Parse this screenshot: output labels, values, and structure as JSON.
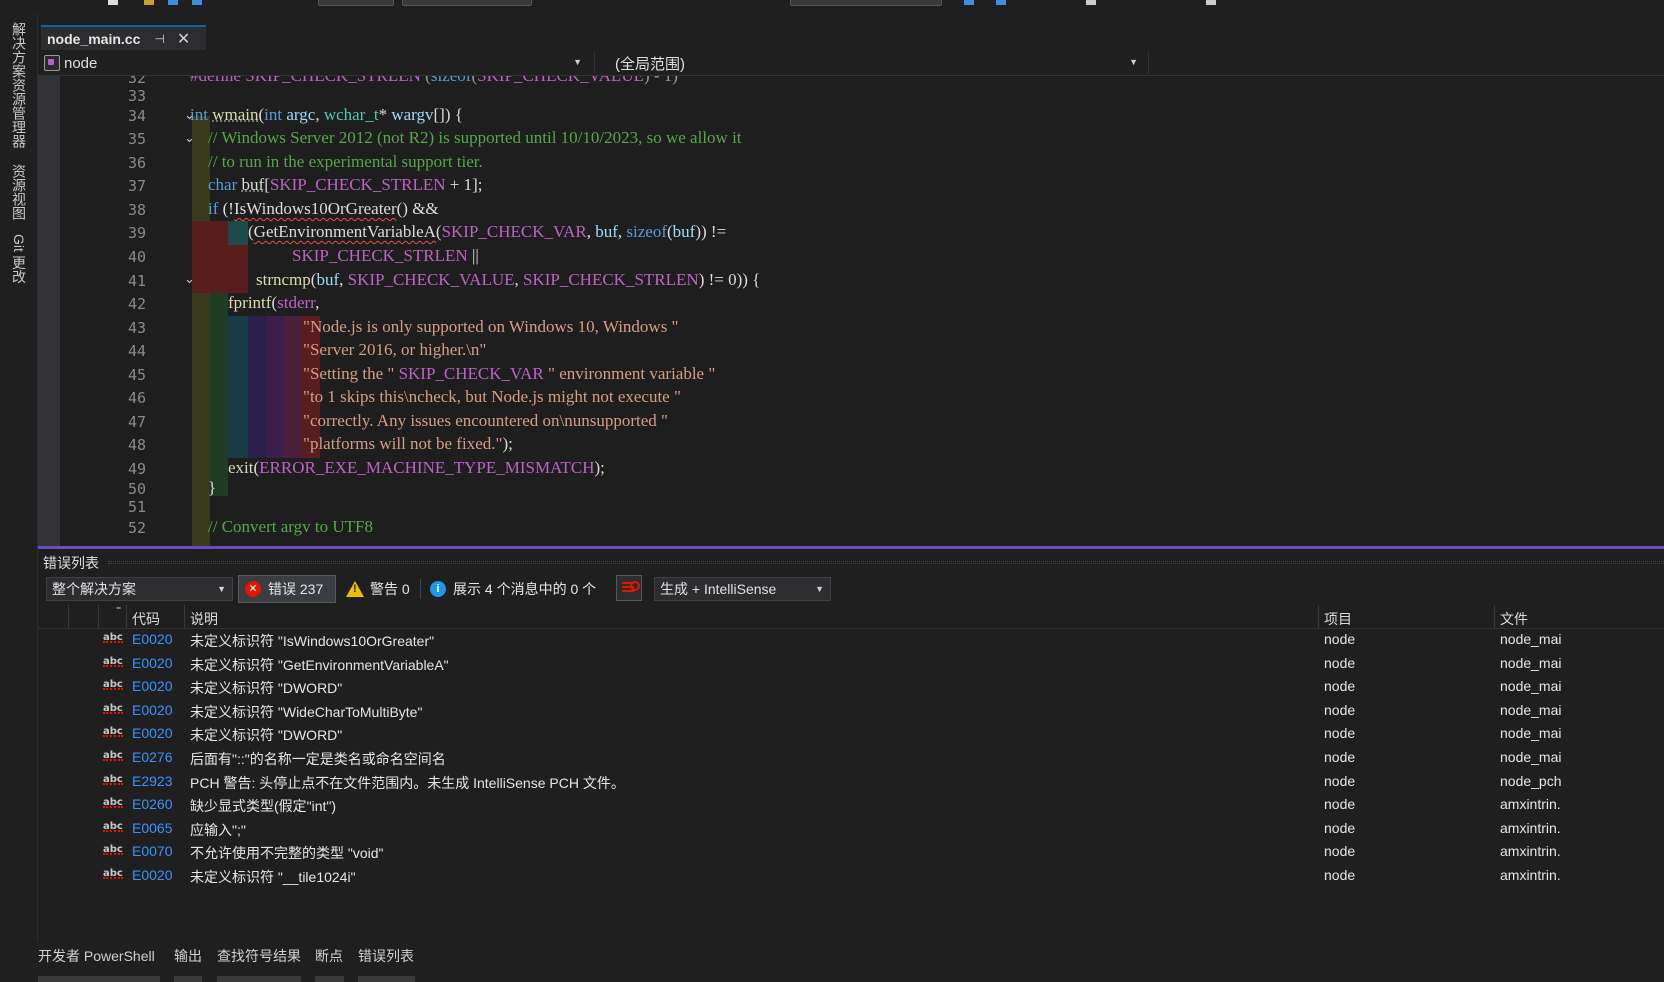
{
  "left_rail": {
    "tabs": [
      "解决方案资源管理器",
      "资源视图",
      "Git 更改"
    ]
  },
  "tab": {
    "title": "node_main.cc",
    "pin": "⊣",
    "close": "✕"
  },
  "navbar": {
    "project": "node",
    "scope": "(全局范围)"
  },
  "editor": {
    "line_numbers": [
      "32",
      "33",
      "34",
      "35",
      "36",
      "37",
      "38",
      "39",
      "40",
      "41",
      "42",
      "43",
      "44",
      "45",
      "46",
      "47",
      "48",
      "49",
      "50",
      "51",
      "52"
    ],
    "lines": [
      "#define SKIP_CHECK_STRLEN (sizeof(SKIP_CHECK_VALUE) - 1)",
      "",
      "int wmain(int argc, wchar_t* wargv[]) {",
      "  // Windows Server 2012 (not R2) is supported until 10/10/2023, so we allow it",
      "  // to run in the experimental support tier.",
      "  char buf[SKIP_CHECK_STRLEN + 1];",
      "  if (!IsWindows10OrGreater() &&",
      "      (GetEnvironmentVariableA(SKIP_CHECK_VAR, buf, sizeof(buf)) !=",
      "           SKIP_CHECK_STRLEN ||",
      "       strncmp(buf, SKIP_CHECK_VALUE, SKIP_CHECK_STRLEN) != 0)) {",
      "    fprintf(stderr,",
      "            \"Node.js is only supported on Windows 10, Windows \"",
      "            \"Server 2016, or higher.\\n\"",
      "            \"Setting the \" SKIP_CHECK_VAR \" environment variable \"",
      "            \"to 1 skips this\\ncheck, but Node.js might not execute \"",
      "            \"correctly. Any issues encountered on\\nunsupported \"",
      "            \"platforms will not be fixed.\");",
      "    exit(ERROR_EXE_MACHINE_TYPE_MISMATCH);",
      "  }",
      "",
      "  // Convert argv to UTF8"
    ],
    "colors": {
      "keyword": "#569cd6",
      "type": "#4ec9b0",
      "function": "#dcdcaa",
      "comment": "#57a64a",
      "string": "#d69d85",
      "macro": "#bd63c5",
      "param": "#9cdcfe"
    }
  },
  "error_list": {
    "title": "错误列表",
    "scope": "整个解决方案",
    "errors_label": "错误 237",
    "warnings_label": "警告 0",
    "messages_label": "展示 4 个消息中的 0 个",
    "build_filter": "生成 + IntelliSense",
    "columns": {
      "code": "代码",
      "description": "说明",
      "project": "项目",
      "file": "文件"
    },
    "rows": [
      {
        "code": "E0020",
        "desc": "未定义标识符 \"IsWindows10OrGreater\"",
        "project": "node",
        "file": "node_mai"
      },
      {
        "code": "E0020",
        "desc": "未定义标识符 \"GetEnvironmentVariableA\"",
        "project": "node",
        "file": "node_mai"
      },
      {
        "code": "E0020",
        "desc": "未定义标识符 \"DWORD\"",
        "project": "node",
        "file": "node_mai"
      },
      {
        "code": "E0020",
        "desc": "未定义标识符 \"WideCharToMultiByte\"",
        "project": "node",
        "file": "node_mai"
      },
      {
        "code": "E0020",
        "desc": "未定义标识符 \"DWORD\"",
        "project": "node",
        "file": "node_mai"
      },
      {
        "code": "E0276",
        "desc": "后面有\"::\"的名称一定是类名或命名空间名",
        "project": "node",
        "file": "node_mai"
      },
      {
        "code": "E2923",
        "desc": "PCH 警告: 头停止点不在文件范围内。未生成 IntelliSense PCH 文件。",
        "project": "node",
        "file": "node_pch"
      },
      {
        "code": "E0260",
        "desc": "缺少显式类型(假定\"int\")",
        "project": "node",
        "file": "amxintrin."
      },
      {
        "code": "E0065",
        "desc": "应输入\";\"",
        "project": "node",
        "file": "amxintrin."
      },
      {
        "code": "E0070",
        "desc": "不允许使用不完整的类型 \"void\"",
        "project": "node",
        "file": "amxintrin."
      },
      {
        "code": "E0020",
        "desc": "未定义标识符 \"__tile1024i\"",
        "project": "node",
        "file": "amxintrin."
      }
    ]
  },
  "bottom_tabs": [
    "开发者 PowerShell",
    "输出",
    "查找符号结果",
    "断点",
    "错误列表"
  ]
}
